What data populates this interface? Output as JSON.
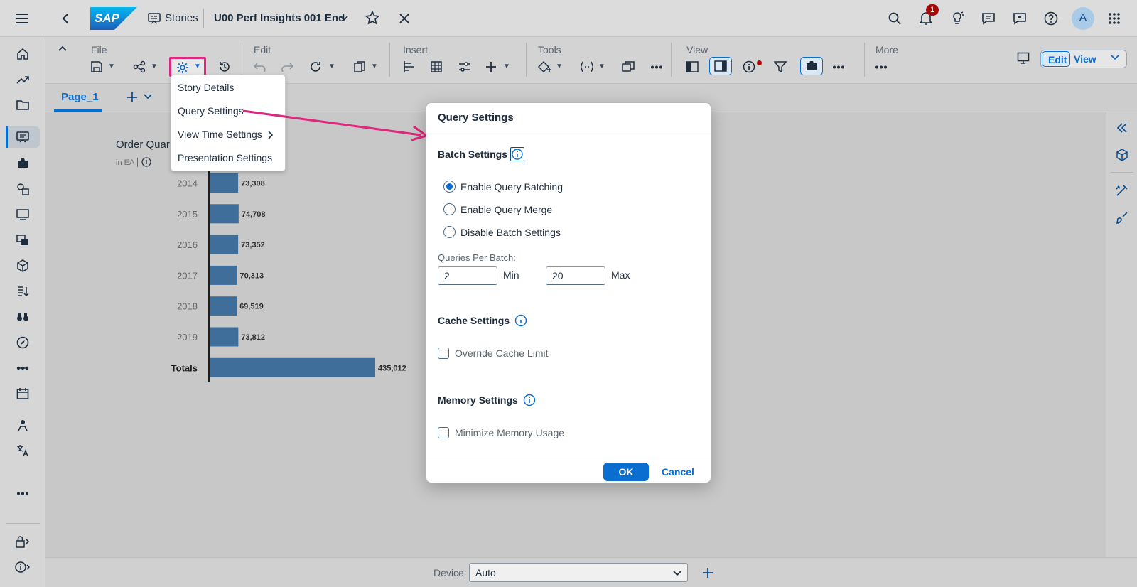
{
  "shell": {
    "logo": "SAP",
    "breadcrumb": "Stories",
    "story_title": "U00 Perf Insights 001 End",
    "notification_count": "1",
    "avatar_initial": "A"
  },
  "toolbar": {
    "groups": {
      "file": "File",
      "edit": "Edit",
      "insert": "Insert",
      "tools": "Tools",
      "view": "View",
      "more": "More"
    },
    "edit_label": "Edit",
    "view_label": "View"
  },
  "settings_menu": {
    "items": [
      "Story Details",
      "Query Settings",
      "View Time Settings",
      "Presentation Settings"
    ]
  },
  "tabs": {
    "page": "Page_1"
  },
  "chart": {
    "title": "Order Quar",
    "unit_label": "in EA"
  },
  "chart_data": {
    "type": "bar",
    "orientation": "horizontal",
    "title": "Order Quar",
    "subtitle": "in EA",
    "categories": [
      "2014",
      "2015",
      "2016",
      "2017",
      "2018",
      "2019",
      "Totals"
    ],
    "values": [
      73308,
      74708,
      73352,
      70313,
      69519,
      73812,
      435012
    ],
    "value_labels": [
      "73,308",
      "74,708",
      "73,352",
      "70,313",
      "69,519",
      "73,812",
      "435,012"
    ],
    "colors": {
      "bar": "#3f6e9a"
    }
  },
  "dialog": {
    "title": "Query Settings",
    "batch_settings": {
      "heading": "Batch Settings",
      "options": [
        "Enable Query Batching",
        "Enable Query Merge",
        "Disable Batch Settings"
      ],
      "selected": "Enable Query Batching",
      "queries_per_batch_label": "Queries Per Batch:",
      "min_value": "2",
      "min_label": "Min",
      "max_value": "20",
      "max_label": "Max"
    },
    "cache_settings": {
      "heading": "Cache Settings",
      "override_label": "Override Cache Limit",
      "override_checked": false
    },
    "memory_settings": {
      "heading": "Memory Settings",
      "minimize_label": "Minimize Memory Usage",
      "minimize_checked": false
    },
    "ok_label": "OK",
    "cancel_label": "Cancel"
  },
  "footer": {
    "device_label": "Device:",
    "device_value": "Auto"
  },
  "colors": {
    "accent": "#0a6ed1",
    "highlight": "#e0267d",
    "bar": "#3f6e9a"
  }
}
